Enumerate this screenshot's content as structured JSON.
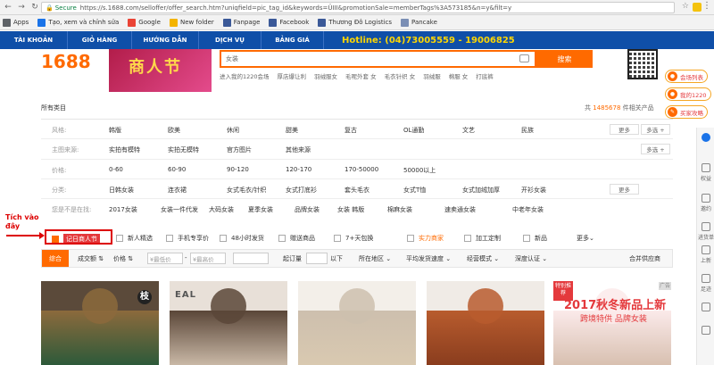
{
  "browser": {
    "secure_label": "Secure",
    "url": "https://s.1688.com/selloffer/offer_search.htm?uniqfield=pic_tag_id&keywords=ÜIII&promotionSale=memberTags%3A573185&n=y&filt=y"
  },
  "bookmarks": [
    {
      "label": "Apps",
      "color": "#5f6368"
    },
    {
      "label": "Tạo, xem và chỉnh sửa",
      "color": "#1a73e8"
    },
    {
      "label": "Google",
      "color": "#ea4335"
    },
    {
      "label": "New folder",
      "color": "#f4b400"
    },
    {
      "label": "Fanpage",
      "color": "#3b5998"
    },
    {
      "label": "Facebook",
      "color": "#3b5998"
    },
    {
      "label": "Thương Đô Logistics",
      "color": "#3b5998"
    },
    {
      "label": "Pancake",
      "color": "#7b8fb5"
    }
  ],
  "topnav": {
    "items": [
      "TÀI KHOẢN",
      "GIỎ HÀNG",
      "HƯỚNG DẪN",
      "DỊCH VỤ",
      "BẢNG GIÁ"
    ],
    "hotline": "Hotline: (04)73005559 - 19006825"
  },
  "header": {
    "logo": "1688",
    "banner_text": "商人节",
    "search_value": "女装",
    "search_button": "搜索",
    "hot_keys": [
      "进入我的1220会场",
      "厚店爆让利",
      "羽绒服女",
      "毛呢外套 女",
      "毛衣针织 女",
      "羽绒服",
      "棉服 女",
      "打底裤"
    ]
  },
  "right_pills": [
    "会场列表",
    "我的1220",
    "买家攻略"
  ],
  "sidebar": [
    {
      "icon": "chat-icon",
      "label": ""
    },
    {
      "icon": "star-icon",
      "label": "权益"
    },
    {
      "icon": "envelope-icon",
      "label": "邀约"
    },
    {
      "icon": "cart-icon",
      "label": "进货单"
    },
    {
      "icon": "arrow-up-icon",
      "label": "上新"
    },
    {
      "icon": "gear-icon",
      "label": "足迹"
    },
    {
      "icon": "heart-icon",
      "label": ""
    },
    {
      "icon": "back-to-top-icon",
      "label": ""
    }
  ],
  "breadcrumb": "所有类目",
  "result_count": {
    "prefix": "共",
    "value": "1485678",
    "suffix": "件相关产品"
  },
  "filters": [
    {
      "label": "风格:",
      "values": [
        "韩版",
        "欧美",
        "休闲",
        "甜美",
        "复古",
        "OL通勤",
        "文艺",
        "民族"
      ],
      "more": "更多",
      "multi": "多选 +"
    },
    {
      "label": "主图来源:",
      "values": [
        "实拍有模特",
        "实拍无模特",
        "官方图片",
        "其他来源"
      ],
      "more": "",
      "multi": "多选 +"
    },
    {
      "label": "价格:",
      "values": [
        "0-60",
        "60-90",
        "90-120",
        "120-170",
        "170-50000",
        "50000以上"
      ],
      "more": "",
      "multi": ""
    },
    {
      "label": "分类:",
      "values": [
        "日韩女装",
        "连衣裙",
        "女式毛衣/针织",
        "女式打底衫",
        "套头毛衣",
        "女式T恤",
        "女式加绒加厚",
        "开衫女装"
      ],
      "more": "更多",
      "multi": ""
    },
    {
      "label": "您是不是在找:",
      "values": [
        "2017女装",
        "女装一件代发",
        "大码女装",
        "夏季女装",
        "品牌女装",
        "女装 韩版",
        "棉麻女装",
        "速卖通女装",
        "中老年女装"
      ],
      "more": "",
      "multi": ""
    }
  ],
  "annotation": {
    "line1": "Tích vào",
    "line2": "đây"
  },
  "checkboxes": [
    {
      "label": "记日商人节",
      "checked": true,
      "highlight": true
    },
    {
      "label": "新人精选",
      "checked": false
    },
    {
      "label": "手机专享价",
      "checked": false
    },
    {
      "label": "48小时发货",
      "checked": false
    },
    {
      "label": "赠送商品",
      "checked": false
    },
    {
      "label": "7+天包换",
      "checked": false
    },
    {
      "label": "实力商家",
      "checked": false,
      "orange": true
    },
    {
      "label": "加工定制",
      "checked": false
    },
    {
      "label": "新品",
      "checked": false
    },
    {
      "label": "更多",
      "checked": false
    }
  ],
  "sortbar": {
    "active": "综合",
    "items": [
      "成交额",
      "价格"
    ],
    "price_from": "¥最低价",
    "price_to": "¥最高价",
    "qty_label": "起订量",
    "qty_suffix": "以下",
    "region": "所在地区",
    "shipping": "平均发货速度",
    "mode": "经营模式",
    "cert": "深度认证",
    "merge": "合并供应商"
  },
  "products": [
    {
      "colors": [
        "#5b4a3a",
        "#8c6a3c",
        "#2d5a3a"
      ],
      "tag": "枝"
    },
    {
      "colors": [
        "#e8e0d8",
        "#5a4638",
        "#c9b8a6"
      ],
      "tag": "EAL"
    },
    {
      "colors": [
        "#f3efe9",
        "#cdbfae",
        "#d9c9b0"
      ],
      "tag": ""
    },
    {
      "colors": [
        "#f0ebe6",
        "#b85c2e",
        "#8a3d1e"
      ],
      "tag": ""
    },
    {
      "colors": [
        "#fff",
        "#fbeaea",
        "#d8c0b0"
      ],
      "tag": ""
    }
  ],
  "promo": {
    "badge": "特别推荐",
    "ad": "广告",
    "title": "2017秋冬新品上新",
    "subtitle": "跨境特供 品牌女装"
  }
}
